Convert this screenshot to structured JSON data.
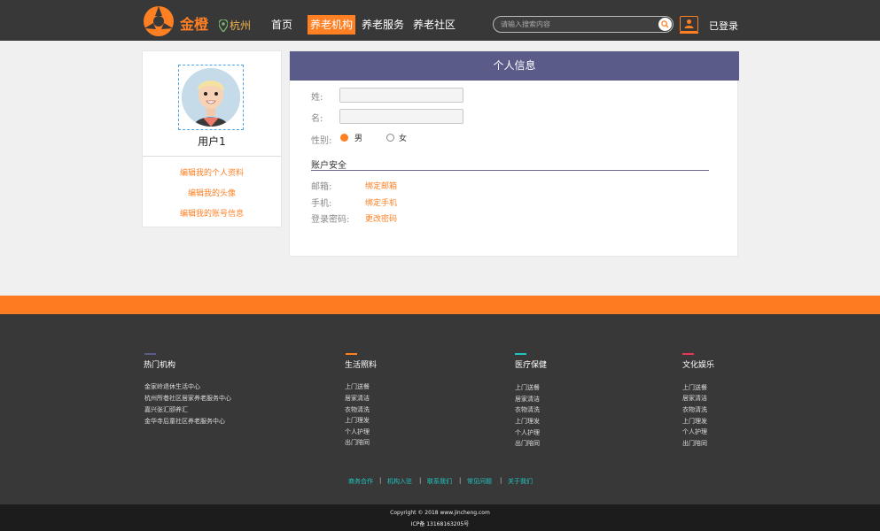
{
  "header": {
    "logo_text": "金橙",
    "city": "杭州",
    "nav": [
      "首页",
      "养老机构",
      "养老服务",
      "养老社区"
    ],
    "active_nav": "养老机构",
    "search_placeholder": "请输入搜索内容",
    "login": "已登录",
    "accent": "#ff7f23"
  },
  "profile": {
    "username": "用户1",
    "links": [
      "编辑我的个人资料",
      "编辑我的头像",
      "编辑我的账号信息"
    ]
  },
  "panel": {
    "title": "个人信息",
    "last_name_label": "姓:",
    "first_name_label": "名:",
    "last_name_value": "",
    "first_name_value": "",
    "gender_label": "性别:",
    "gender_options": [
      "男",
      "女"
    ],
    "gender_selected": "男",
    "security_title": "账户安全",
    "email_label": "邮箱:",
    "email_link": "绑定邮箱",
    "phone_label": "手机:",
    "phone_link": "绑定手机",
    "password_label": "登录密码:",
    "password_link": "更改密码"
  },
  "footer": {
    "columns": [
      {
        "title": "热门机构",
        "color": "#5b5b8a",
        "items": [
          "金家岭退休生活中心",
          "杭州所巷社区居家养老服务中心",
          "嘉兴张汇颐养汇",
          "金华寺后童社区养老服务中心"
        ]
      },
      {
        "title": "生活照料",
        "color": "#ff7f23",
        "items": [
          "上门送餐",
          "居家清洁",
          "衣物清洗",
          "上门理发",
          "个人护理",
          "出门陪同"
        ]
      },
      {
        "title": "医疗保健",
        "color": "#1fc6c1",
        "items": [
          "上门送餐",
          "居家清洁",
          "衣物清洗",
          "上门理发",
          "个人护理",
          "出门陪同"
        ]
      },
      {
        "title": "文化娱乐",
        "color": "#e8385a",
        "items": [
          "上门送餐",
          "居家清洁",
          "衣物清洗",
          "上门理发",
          "个人护理",
          "出门陪同"
        ]
      }
    ],
    "links": [
      "商务合作",
      "机构入驻",
      "联系我们",
      "常见问题",
      "关于我们"
    ],
    "copyright": "Copyright © 2018 www.jincheng.com",
    "icp": "ICP备 13168163205号"
  }
}
